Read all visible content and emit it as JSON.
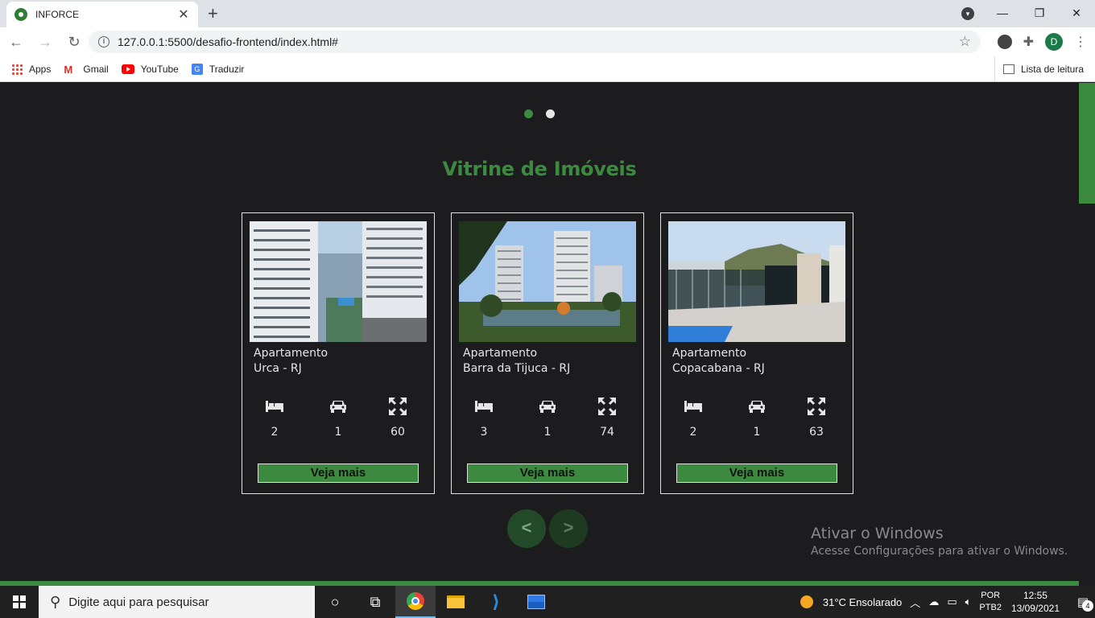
{
  "browser": {
    "tab_title": "INFORCE",
    "tab_close": "✕",
    "new_tab": "+",
    "url": "127.0.0.1:5500/desafio-frontend/index.html#",
    "avatar_letter": "D",
    "bookmarks": [
      {
        "label": "Apps",
        "icon": "apps-grid-icon"
      },
      {
        "label": "Gmail",
        "icon": "gmail-icon"
      },
      {
        "label": "YouTube",
        "icon": "youtube-icon"
      },
      {
        "label": "Traduzir",
        "icon": "translate-icon"
      }
    ],
    "reading_list": "Lista de leitura",
    "controls": {
      "minimize": "—",
      "restore": "❐",
      "close": "✕"
    }
  },
  "page": {
    "section_title": "Vitrine de Imóveis",
    "accent_color": "#3c8a3f",
    "carousel_dots": 2,
    "active_dot": 0,
    "cards": [
      {
        "type": "Apartamento",
        "location": "Urca - RJ",
        "bedrooms": "2",
        "parking": "1",
        "area": "60",
        "button": "Veja mais"
      },
      {
        "type": "Apartamento",
        "location": "Barra da Tijuca - RJ",
        "bedrooms": "3",
        "parking": "1",
        "area": "74",
        "button": "Veja mais"
      },
      {
        "type": "Apartamento",
        "location": "Copacabana - RJ",
        "bedrooms": "2",
        "parking": "1",
        "area": "63",
        "button": "Veja mais"
      }
    ],
    "prev_label": "<",
    "next_label": ">"
  },
  "watermark": {
    "title": "Ativar o Windows",
    "subtitle": "Acesse Configurações para ativar o Windows."
  },
  "taskbar": {
    "search_placeholder": "Digite aqui para pesquisar",
    "weather": "31°C  Ensolarado",
    "lang_top": "POR",
    "lang_bottom": "PTB2",
    "time": "12:55",
    "date": "13/09/2021",
    "notifications": "4"
  }
}
